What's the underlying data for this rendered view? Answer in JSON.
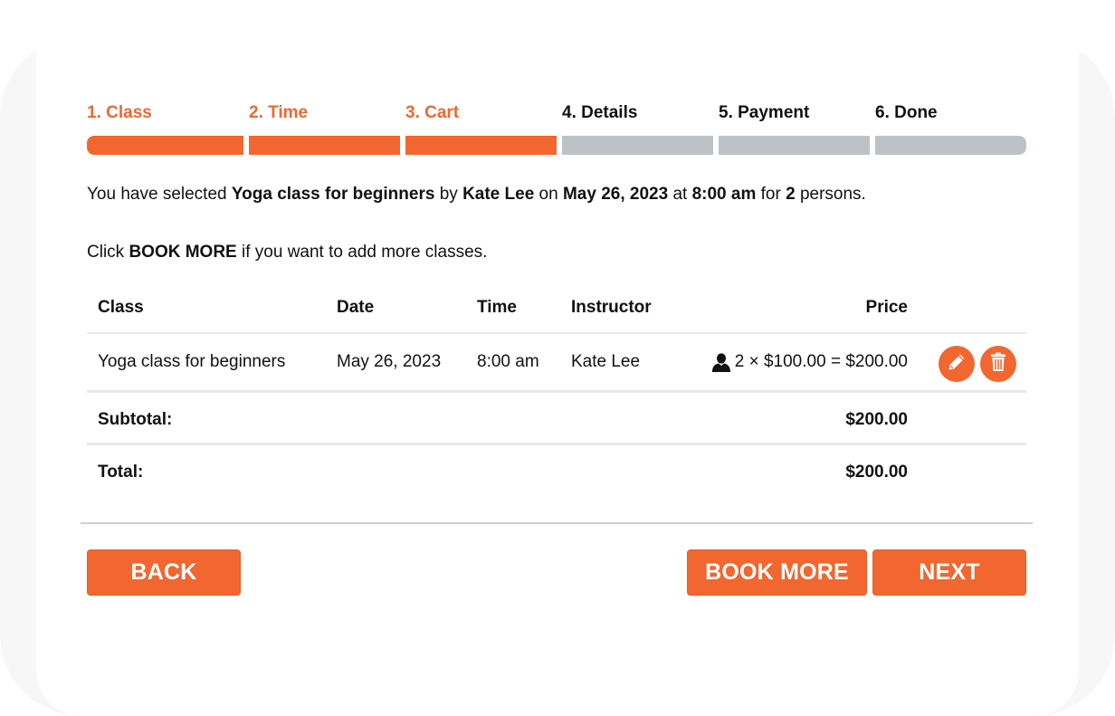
{
  "colors": {
    "accent": "#f26630",
    "inactive_step": "#bec2c6",
    "text": "#111111"
  },
  "steps": [
    {
      "label": "1. Class",
      "state": "completed"
    },
    {
      "label": "2. Time",
      "state": "completed"
    },
    {
      "label": "3. Cart",
      "state": "current"
    },
    {
      "label": "4. Details",
      "state": "upcoming"
    },
    {
      "label": "5. Payment",
      "state": "upcoming"
    },
    {
      "label": "6. Done",
      "state": "upcoming"
    }
  ],
  "summary": {
    "prefix": "You have selected ",
    "class_name": "Yoga class for beginners",
    "by": " by ",
    "instructor": "Kate Lee",
    "on": " on ",
    "date": "May 26, 2023",
    "at": " at ",
    "time": "8:00 am",
    "for": " for ",
    "persons_count": "2",
    "suffix": " persons."
  },
  "hint": {
    "prefix": "Click ",
    "action": "BOOK MORE",
    "suffix": " if you want to add more classes."
  },
  "table": {
    "headers": {
      "class": "Class",
      "date": "Date",
      "time": "Time",
      "instructor": "Instructor",
      "price": "Price"
    },
    "rows": [
      {
        "class": "Yoga class for beginners",
        "date": "May 26, 2023",
        "time": "8:00 am",
        "instructor": "Kate Lee",
        "price": "2 × $100.00 = $200.00",
        "icons": {
          "persons": "person-icon",
          "edit": "pencil-icon",
          "delete": "trash-icon"
        }
      }
    ],
    "subtotal": {
      "label": "Subtotal:",
      "value": "$200.00"
    },
    "total": {
      "label": "Total:",
      "value": "$200.00"
    }
  },
  "buttons": {
    "back": "BACK",
    "book_more": "BOOK MORE",
    "next": "NEXT"
  }
}
